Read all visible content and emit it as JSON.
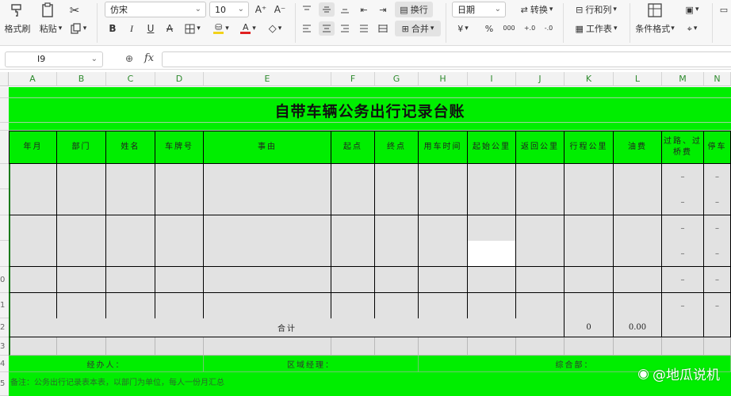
{
  "ribbon": {
    "format_painter": "格式刷",
    "paste": "粘贴",
    "font_name": "仿宋",
    "font_size": "10",
    "bold": "B",
    "italic": "I",
    "underline": "U",
    "strike": "A",
    "font_grow": "A⁺",
    "font_shrink": "A⁻",
    "wrap": "换行",
    "merge": "合并",
    "number_format": "日期",
    "currency": "¥",
    "percent": "%",
    "thousands": "000",
    "convert": "转换",
    "rows_cols": "行和列",
    "worksheet": "工作表",
    "conditional_format": "条件格式",
    "icons": {
      "cut": "scissors-icon",
      "copy": "copy-icon",
      "borders": "borders-icon",
      "fill": "fill-color-icon",
      "font_color": "font-color-icon",
      "clear": "eraser-icon"
    },
    "accent_fill": "#f2d21b",
    "accent_font": "#e02020"
  },
  "formula_bar": {
    "cell_ref": "I9",
    "fx": "fx",
    "content": ""
  },
  "columns": [
    "A",
    "B",
    "C",
    "D",
    "E",
    "F",
    "G",
    "H",
    "I",
    "J",
    "K",
    "L",
    "M",
    "N"
  ],
  "row_numbers": [
    "0",
    "1",
    "2",
    "3",
    "4",
    "5"
  ],
  "sheet": {
    "title": "自带车辆公务出行记录台账",
    "headers": [
      "年月",
      "部门",
      "姓名",
      "车牌号",
      "事由",
      "起点",
      "终点",
      "用车时间",
      "起始公里",
      "返回公里",
      "行程公里",
      "油费",
      "过路、过桥费",
      "停车"
    ],
    "placeholder_dash": "–",
    "total_label": "合计",
    "total_km": "0",
    "total_fuel": "0.00",
    "sign_handler": "经办人：",
    "sign_region": "区域经理：",
    "sign_dept": "综合部：",
    "note": "备注：公务出行记录表本表，以部门为单位，每人一份月汇总"
  },
  "colors": {
    "band_green": "#00ee00",
    "data_gray": "#e2e2e2",
    "header_green_text": "#2e8b2e"
  },
  "watermark": "@地瓜说机"
}
